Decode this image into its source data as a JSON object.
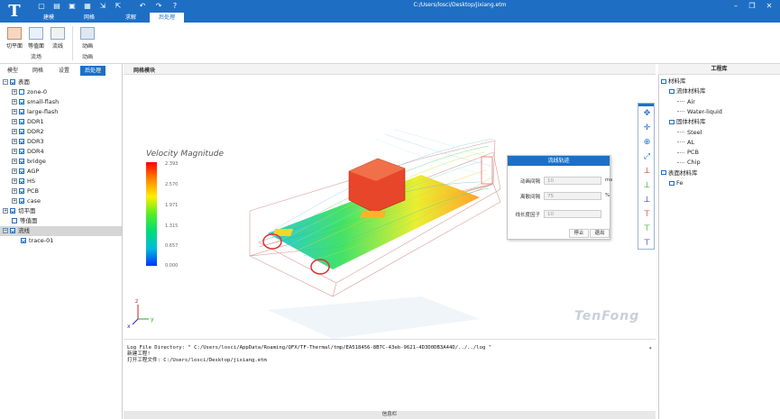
{
  "titlebar": {
    "path": "C:/Users/losci/Desktop/jixiang.etm",
    "tabs": [
      "建模",
      "网格",
      "求解",
      "后处理"
    ],
    "window_buttons": [
      "minimize-icon",
      "restore-icon",
      "close-icon"
    ],
    "quick_icons": [
      "new-file-icon",
      "open-file-icon",
      "save-icon",
      "save-as-icon",
      "import-icon",
      "export-icon",
      "undo-icon",
      "redo-icon",
      "help-icon"
    ]
  },
  "ribbon": {
    "buttons": [
      {
        "label": "切平面",
        "icon": "cut-plane-icon"
      },
      {
        "label": "等值面",
        "icon": "isosurface-icon"
      },
      {
        "label": "流线",
        "icon": "streamline-icon"
      },
      {
        "label": "动画",
        "icon": "animation-icon"
      }
    ],
    "groups": [
      "流场",
      "动画"
    ]
  },
  "left": {
    "tabs": [
      "模型",
      "网格",
      "设置",
      "后处理"
    ],
    "tree": [
      {
        "label": "表面",
        "level": 0,
        "expand": "−",
        "check": true
      },
      {
        "label": "zone-0",
        "level": 1,
        "expand": "+",
        "check": false
      },
      {
        "label": "small-flash",
        "level": 1,
        "expand": "+",
        "check": true
      },
      {
        "label": "large-flash",
        "level": 1,
        "expand": "+",
        "check": true
      },
      {
        "label": "DDR1",
        "level": 1,
        "expand": "+",
        "check": true
      },
      {
        "label": "DDR2",
        "level": 1,
        "expand": "+",
        "check": true
      },
      {
        "label": "DDR3",
        "level": 1,
        "expand": "+",
        "check": true
      },
      {
        "label": "DDR4",
        "level": 1,
        "expand": "+",
        "check": true
      },
      {
        "label": "bridge",
        "level": 1,
        "expand": "+",
        "check": true
      },
      {
        "label": "AGP",
        "level": 1,
        "expand": "+",
        "check": true
      },
      {
        "label": "HS",
        "level": 1,
        "expand": "+",
        "check": true
      },
      {
        "label": "PCB",
        "level": 1,
        "expand": "+",
        "check": true
      },
      {
        "label": "case",
        "level": 1,
        "expand": "+",
        "check": true
      },
      {
        "label": "切平面",
        "level": 0,
        "expand": "+",
        "check": true
      },
      {
        "label": "等值面",
        "level": 0,
        "expand": "",
        "check": false
      },
      {
        "label": "流线",
        "level": 0,
        "expand": "−",
        "check": true,
        "selected": true
      },
      {
        "label": "trace-01",
        "level": 1,
        "expand": "",
        "check": true
      }
    ]
  },
  "view": {
    "title": "网格模块",
    "legend_title": "Velocity Magnitude",
    "legend_ticks": [
      "2.393",
      "2.570",
      "1.971",
      "1.315",
      "0.657",
      "0.000"
    ],
    "watermark": "TenFong"
  },
  "dialog": {
    "title": "流线轨迹",
    "rows": [
      {
        "label": "动画间隔",
        "value": "10",
        "unit": "ms"
      },
      {
        "label": "离散间隔",
        "value": "75",
        "unit": "%"
      },
      {
        "label": "线长度因子",
        "value": "10",
        "unit": ""
      }
    ],
    "stop": "停止",
    "exit": "退出"
  },
  "console": {
    "lines": [
      "Log File Directory: \" C:/Users/losci/AppData/Roaming/QFX/TF-Thermal/tmp/EA518456-8B7C-43eb-9621-4D3D0DB3A44D/../../log \"",
      "新建工程!",
      "打开工程文件: C:/Users/losci/Desktop/jixiang.etm"
    ]
  },
  "status": {
    "label": "信息栏"
  },
  "right": {
    "title": "工程库",
    "tree": [
      {
        "label": "材料库",
        "level": 0
      },
      {
        "label": "流体材料库",
        "level": 1
      },
      {
        "label": "Air",
        "level": 2
      },
      {
        "label": "Water-liquid",
        "level": 2
      },
      {
        "label": "固体材料库",
        "level": 1
      },
      {
        "label": "Steel",
        "level": 2
      },
      {
        "label": "AL",
        "level": 2
      },
      {
        "label": "PCB",
        "level": 2
      },
      {
        "label": "Chip",
        "level": 2
      },
      {
        "label": "表面材料库",
        "level": 0
      },
      {
        "label": "Fe",
        "level": 1
      }
    ]
  },
  "view_tools": [
    "rotate-icon",
    "pan-icon",
    "zoom-icon",
    "fit-view-icon",
    "view-x-icon",
    "view-y-icon",
    "view-z-icon",
    "view-neg-x-icon",
    "view-neg-y-icon",
    "view-neg-z-icon"
  ]
}
